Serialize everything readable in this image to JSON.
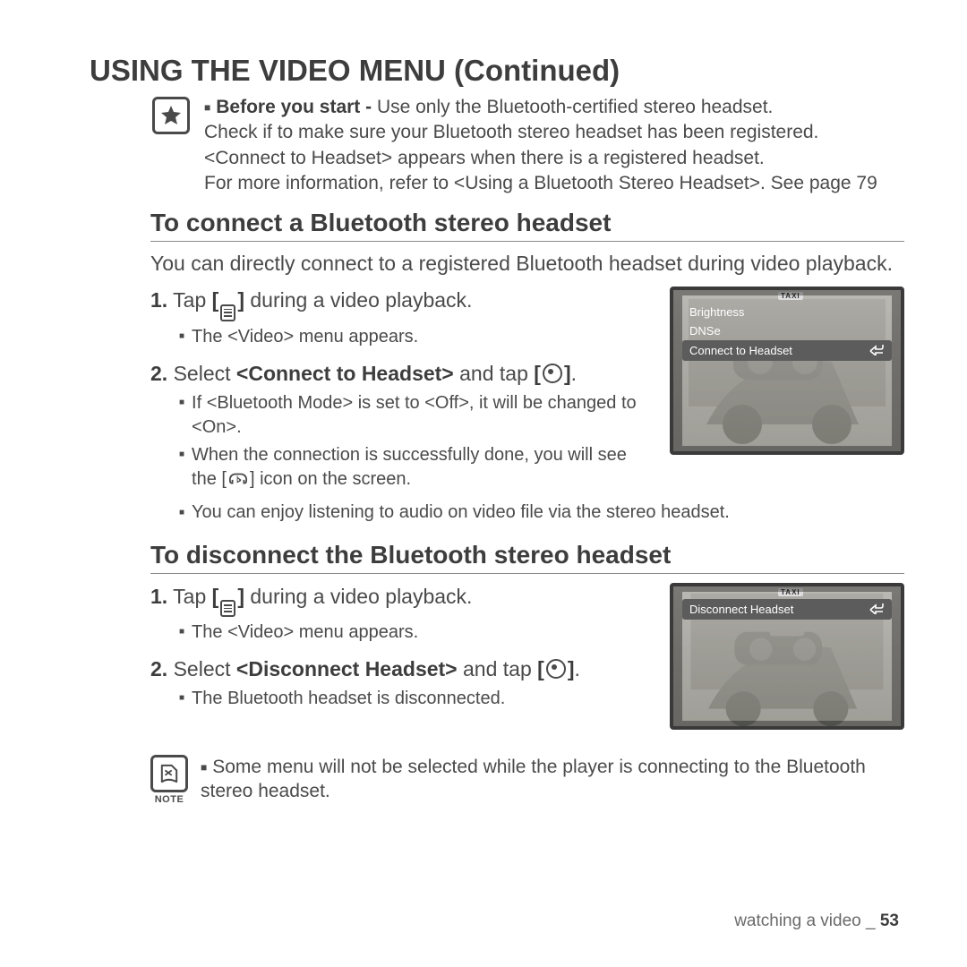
{
  "title": "USING THE VIDEO MENU (Continued)",
  "before_start": {
    "lead": "Before you start - ",
    "l1": "Use only the Bluetooth-certified stereo headset.",
    "l2": "Check if to make sure your Bluetooth stereo headset has been registered.",
    "l3": "<Connect to Headset> appears when there is a registered headset.",
    "l4": "For more information, refer to <Using a Bluetooth Stereo Headset>. See page 79"
  },
  "section_connect": {
    "heading": "To connect a Bluetooth stereo headset",
    "intro": "You can directly connect to a registered Bluetooth headset during video playback.",
    "step1_pre": "Tap ",
    "step1_post": " during a video playback.",
    "step1_sub": "The <Video> menu appears.",
    "step2_pre": "Select ",
    "step2_bold": "<Connect to Headset>",
    "step2_mid": " and tap ",
    "step2_sub1": "If <Bluetooth Mode> is set to <Off>, it will be changed to <On>.",
    "step2_sub2a": "When the connection is successfully done, you will see the [",
    "step2_sub2b": "] icon on the screen.",
    "step2_sub3": "You can enjoy listening to audio on video file via the stereo headset."
  },
  "device1": {
    "row1": "Brightness",
    "row2": "DNSe",
    "row3": "Connect to Headset",
    "taxi": "TAXI"
  },
  "section_disconnect": {
    "heading": "To disconnect the Bluetooth stereo headset",
    "step1_pre": "Tap ",
    "step1_post": " during a video playback.",
    "step1_sub": "The <Video> menu appears.",
    "step2_pre": "Select ",
    "step2_bold": "<Disconnect Headset>",
    "step2_mid": " and tap ",
    "step2_sub": "The Bluetooth headset is disconnected."
  },
  "device2": {
    "row1": "Disconnect Headset",
    "taxi": "TAXI"
  },
  "note": {
    "label": "NOTE",
    "text": "Some menu will not be selected while the player is connecting to the Bluetooth stereo headset."
  },
  "footer": {
    "text": "watching a video _ ",
    "page": "53"
  },
  "numbers": {
    "n1": "1.",
    "n2": "2."
  },
  "brackets": {
    "open": "[",
    "close": "]",
    "period": "."
  }
}
